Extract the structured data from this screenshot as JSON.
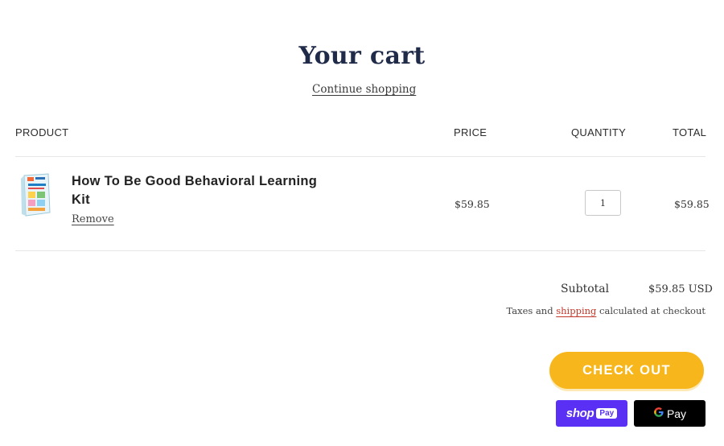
{
  "page": {
    "title": "Your cart",
    "continue_link": "Continue shopping"
  },
  "table": {
    "headers": {
      "product": "PRODUCT",
      "price": "PRICE",
      "quantity": "QUANTITY",
      "total": "TOTAL"
    },
    "items": [
      {
        "name": "How To Be Good Behavioral Learning Kit",
        "remove_label": "Remove",
        "price": "$59.85",
        "quantity": "1",
        "total": "$59.85",
        "thumbnail_icon": "product-box-image"
      }
    ]
  },
  "summary": {
    "subtotal_label": "Subtotal",
    "subtotal_value": "$59.85 USD",
    "tax_prefix": "Taxes and ",
    "tax_link": "shipping",
    "tax_suffix": " calculated at checkout"
  },
  "actions": {
    "checkout_label": "CHECK OUT",
    "shop_pay_label": "shop",
    "shop_pay_badge": "Pay",
    "gpay_label": "Pay"
  },
  "colors": {
    "title": "#1f2b49",
    "checkout": "#f7b71c",
    "shop_pay": "#5a31f4",
    "shipping_link": "#c0392b"
  }
}
